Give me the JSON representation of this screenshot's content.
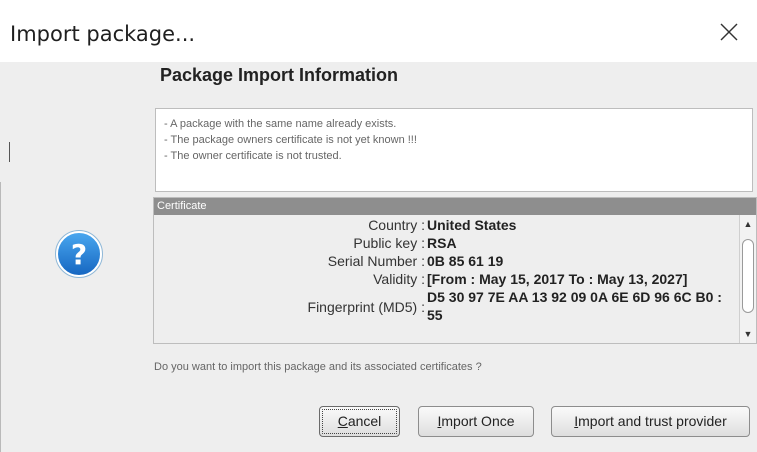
{
  "window": {
    "title": "Import package...",
    "close_icon": "close-x-icon"
  },
  "heading": "Package Import Information",
  "info_lines": [
    "- A package with the same name already exists.",
    "- The package owners certificate is not yet known !!!",
    "- The owner certificate is not trusted."
  ],
  "icon": "question-icon",
  "certificate": {
    "header": "Certificate",
    "rows": [
      {
        "label": "Country",
        "value": "United States"
      },
      {
        "label": "Public key",
        "value": "RSA"
      },
      {
        "label": "Serial Number",
        "value": "0B 85 61 19"
      },
      {
        "label": "Validity",
        "value": "[From : May 15, 2017 To : May 13, 2027]"
      },
      {
        "label": "Fingerprint (MD5)",
        "value": "D5 30 97 7E AA 13 92 09 0A 6E 6D 96 6C B0 :",
        "value2": "55"
      }
    ]
  },
  "question": "Do you want to import this package and its associated certificates ?",
  "buttons": {
    "cancel_mnemonic": "C",
    "cancel_rest": "ancel",
    "import_once_mnemonic": "I",
    "import_once_rest": "mport Once",
    "import_trust_mnemonic": "I",
    "import_trust_rest": "mport and trust provider"
  },
  "colors": {
    "dialog_bg": "#eeeeee",
    "cert_header_bg": "#8e8e8e",
    "icon_blue": "#1e88e5"
  }
}
